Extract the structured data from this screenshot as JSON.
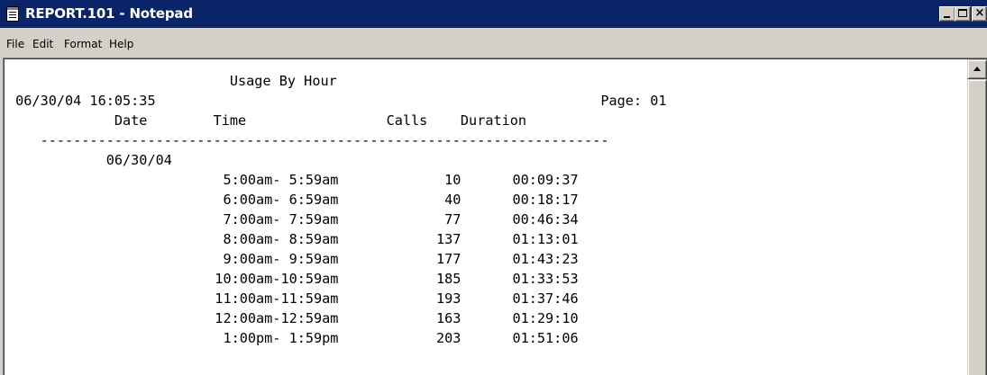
{
  "window": {
    "title": "REPORT.101 - Notepad",
    "icon": "notepad-icon",
    "controls": {
      "minimize": "_",
      "maximize": "□",
      "close": "×"
    }
  },
  "menu": {
    "items": [
      "File",
      "Edit",
      "Format",
      "Help"
    ]
  },
  "document": {
    "title_line": "                           Usage By Hour",
    "header_line": " 06/30/04 16:05:35                                                      Page: 01",
    "columns_line": "             Date        Time                 Calls    Duration",
    "rule_line": "    ---------------------------------------------------------------------",
    "date_line": "            06/30/04",
    "rows": [
      {
        "time": "5:00am- 5:59am",
        "calls": "10",
        "duration": "00:09:37"
      },
      {
        "time": "6:00am- 6:59am",
        "calls": "40",
        "duration": "00:18:17"
      },
      {
        "time": "7:00am- 7:59am",
        "calls": "77",
        "duration": "00:46:34"
      },
      {
        "time": "8:00am- 8:59am",
        "calls": "137",
        "duration": "01:13:01"
      },
      {
        "time": "9:00am- 9:59am",
        "calls": "177",
        "duration": "01:43:23"
      },
      {
        "time": "10:00am-10:59am",
        "calls": "185",
        "duration": "01:33:53"
      },
      {
        "time": "11:00am-11:59am",
        "calls": "193",
        "duration": "01:37:46"
      },
      {
        "time": "12:00am-12:59am",
        "calls": "163",
        "duration": "01:29:10"
      },
      {
        "time": "1:00pm- 1:59pm",
        "calls": "203",
        "duration": "01:51:06"
      }
    ]
  },
  "colors": {
    "titlebar": "#0a246a",
    "chrome": "#d4d0c8",
    "text": "#000000",
    "page": "#ffffff"
  }
}
